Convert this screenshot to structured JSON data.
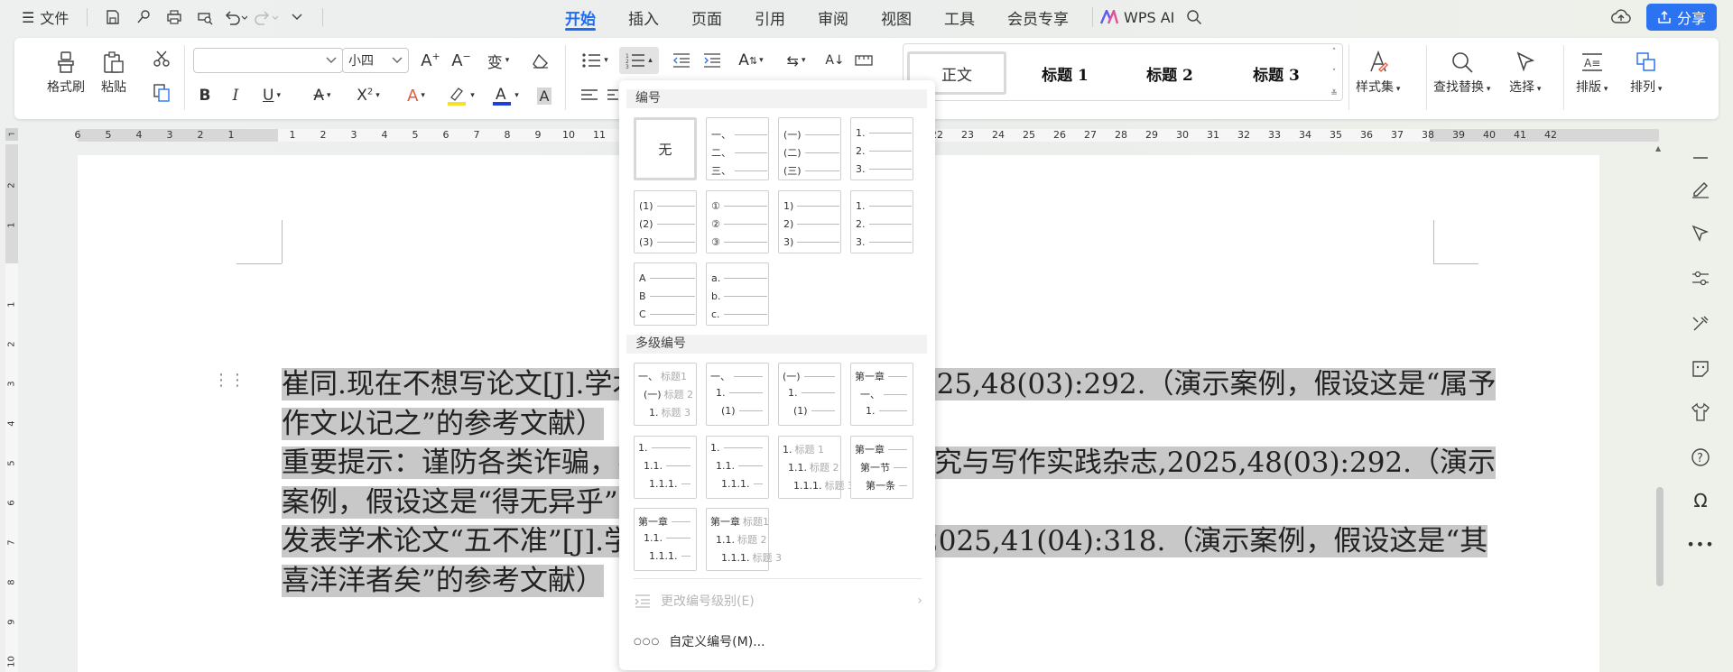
{
  "topbar": {
    "file_label": "文件",
    "tabs": [
      "开始",
      "插入",
      "页面",
      "引用",
      "审阅",
      "视图",
      "工具",
      "会员专享"
    ],
    "wps_ai": "WPS AI",
    "share": "分享"
  },
  "ribbon": {
    "format_painter": "格式刷",
    "paste": "粘贴",
    "font_name": "",
    "font_size": "小四",
    "styles": [
      "正文",
      "标题 1",
      "标题 2",
      "标题 3"
    ],
    "style_set": "样式集",
    "find_replace": "查找替换",
    "select": "选择",
    "layout": "排版",
    "arrange": "排列"
  },
  "ruler": {
    "numbers": [
      "6",
      "5",
      "4",
      "3",
      "2",
      "1",
      "",
      "1",
      "2",
      "3",
      "4",
      "5",
      "6",
      "7",
      "8",
      "9",
      "10",
      "11",
      "12",
      "13",
      "14",
      "15",
      "16",
      "17",
      "18",
      "19",
      "20",
      "21",
      "22",
      "23",
      "24",
      "25",
      "26",
      "27",
      "28",
      "29",
      "30",
      "31",
      "32",
      "33",
      "34",
      "35",
      "36",
      "37",
      "38",
      "39",
      "40",
      "41",
      "42"
    ],
    "vnumbers": [
      "2",
      "1",
      "",
      "1",
      "2",
      "3",
      "4",
      "5",
      "6",
      "7",
      "8",
      "9",
      "10"
    ]
  },
  "document": {
    "paragraphs": [
      "崔同.现在不想写论文[J].学术研究与写作实践杂志,2025,48(03):292.（演示案例，假设这是“属予作文以记之”的参考文献）",
      "重要提示：谨防各类诈骗，不要轻信陌生来电.学术研究与写作实践杂志,2025,48(03):292.（演示案例，假设这是“得无异乎”的参考文献）",
      "发表学术论文“五不准”[J].学术研究与写作实践杂志,2025,41(04):318.（演示案例，假设这是“其喜洋洋者矣”的参考文献）"
    ]
  },
  "dropdown": {
    "section_numbering": "编号",
    "section_multilevel": "多级编号",
    "none_label": "无",
    "numbering_tiles": [
      {
        "lines": [
          "一、",
          "二、",
          "三、"
        ]
      },
      {
        "lines": [
          "(一)",
          "(二)",
          "(三)"
        ]
      },
      {
        "lines": [
          "1.",
          "2.",
          "3."
        ]
      },
      {
        "lines": [
          "(1)",
          "(2)",
          "(3)"
        ]
      },
      {
        "lines": [
          "①",
          "②",
          "③"
        ]
      },
      {
        "lines": [
          "1)",
          "2)",
          "3)"
        ]
      },
      {
        "lines": [
          "1.",
          "2.",
          "3."
        ]
      },
      {
        "lines": [
          "A",
          "B",
          "C"
        ]
      },
      {
        "lines": [
          "a.",
          "b.",
          "c."
        ]
      }
    ],
    "multilevel_tiles": [
      {
        "lines": [
          [
            "一、",
            "标题1"
          ],
          [
            "(一)",
            "标题 2"
          ],
          [
            "1.",
            "标题 3"
          ]
        ]
      },
      {
        "lines": [
          [
            "一、",
            ""
          ],
          [
            "1.",
            ""
          ],
          [
            "(1)",
            ""
          ]
        ]
      },
      {
        "lines": [
          [
            "(一)",
            ""
          ],
          [
            "1.",
            ""
          ],
          [
            "(1)",
            ""
          ]
        ]
      },
      {
        "lines": [
          [
            "第一章",
            ""
          ],
          [
            "一、",
            ""
          ],
          [
            "1.",
            ""
          ]
        ]
      },
      {
        "lines": [
          [
            "1.",
            ""
          ],
          [
            "1.1.",
            ""
          ],
          [
            "1.1.1.",
            ""
          ]
        ]
      },
      {
        "lines": [
          [
            "1.",
            ""
          ],
          [
            "1.1.",
            ""
          ],
          [
            "1.1.1.",
            ""
          ]
        ]
      },
      {
        "lines": [
          [
            "1.",
            "标题 1"
          ],
          [
            "1.1.",
            "标题 2"
          ],
          [
            "1.1.1.",
            "标题 3"
          ]
        ]
      },
      {
        "lines": [
          [
            "第一章",
            ""
          ],
          [
            "第一节",
            ""
          ],
          [
            "第一条",
            ""
          ]
        ]
      },
      {
        "lines": [
          [
            "第一章",
            ""
          ],
          [
            "1.1.",
            ""
          ],
          [
            "1.1.1.",
            ""
          ]
        ]
      },
      {
        "lines": [
          [
            "第一章",
            "标题1"
          ],
          [
            "1.1.",
            "标题 2"
          ],
          [
            "1.1.1.",
            "标题 3"
          ]
        ]
      }
    ],
    "change_level": "更改编号级别(E)",
    "custom_numbering": "自定义编号(M)..."
  },
  "colors": {
    "accent": "#1d6cf1",
    "highlight": "#c8c8c8",
    "font_color_bar": "#1f3fd8",
    "highlight_bar": "#f5e12a"
  }
}
